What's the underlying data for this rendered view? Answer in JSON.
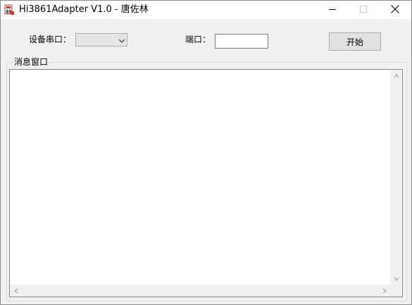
{
  "window": {
    "title": "Hi3861Adapter V1.0 - 唐佐林",
    "icons": [
      "app-icon",
      "minimize-icon",
      "maximize-icon",
      "close-icon"
    ]
  },
  "toolbar": {
    "device_port_label": "设备串口：",
    "device_port_value": "",
    "port_label": "端口：",
    "port_value": "",
    "start_label": "开始"
  },
  "message_panel": {
    "title": "消息窗口",
    "content": ""
  }
}
